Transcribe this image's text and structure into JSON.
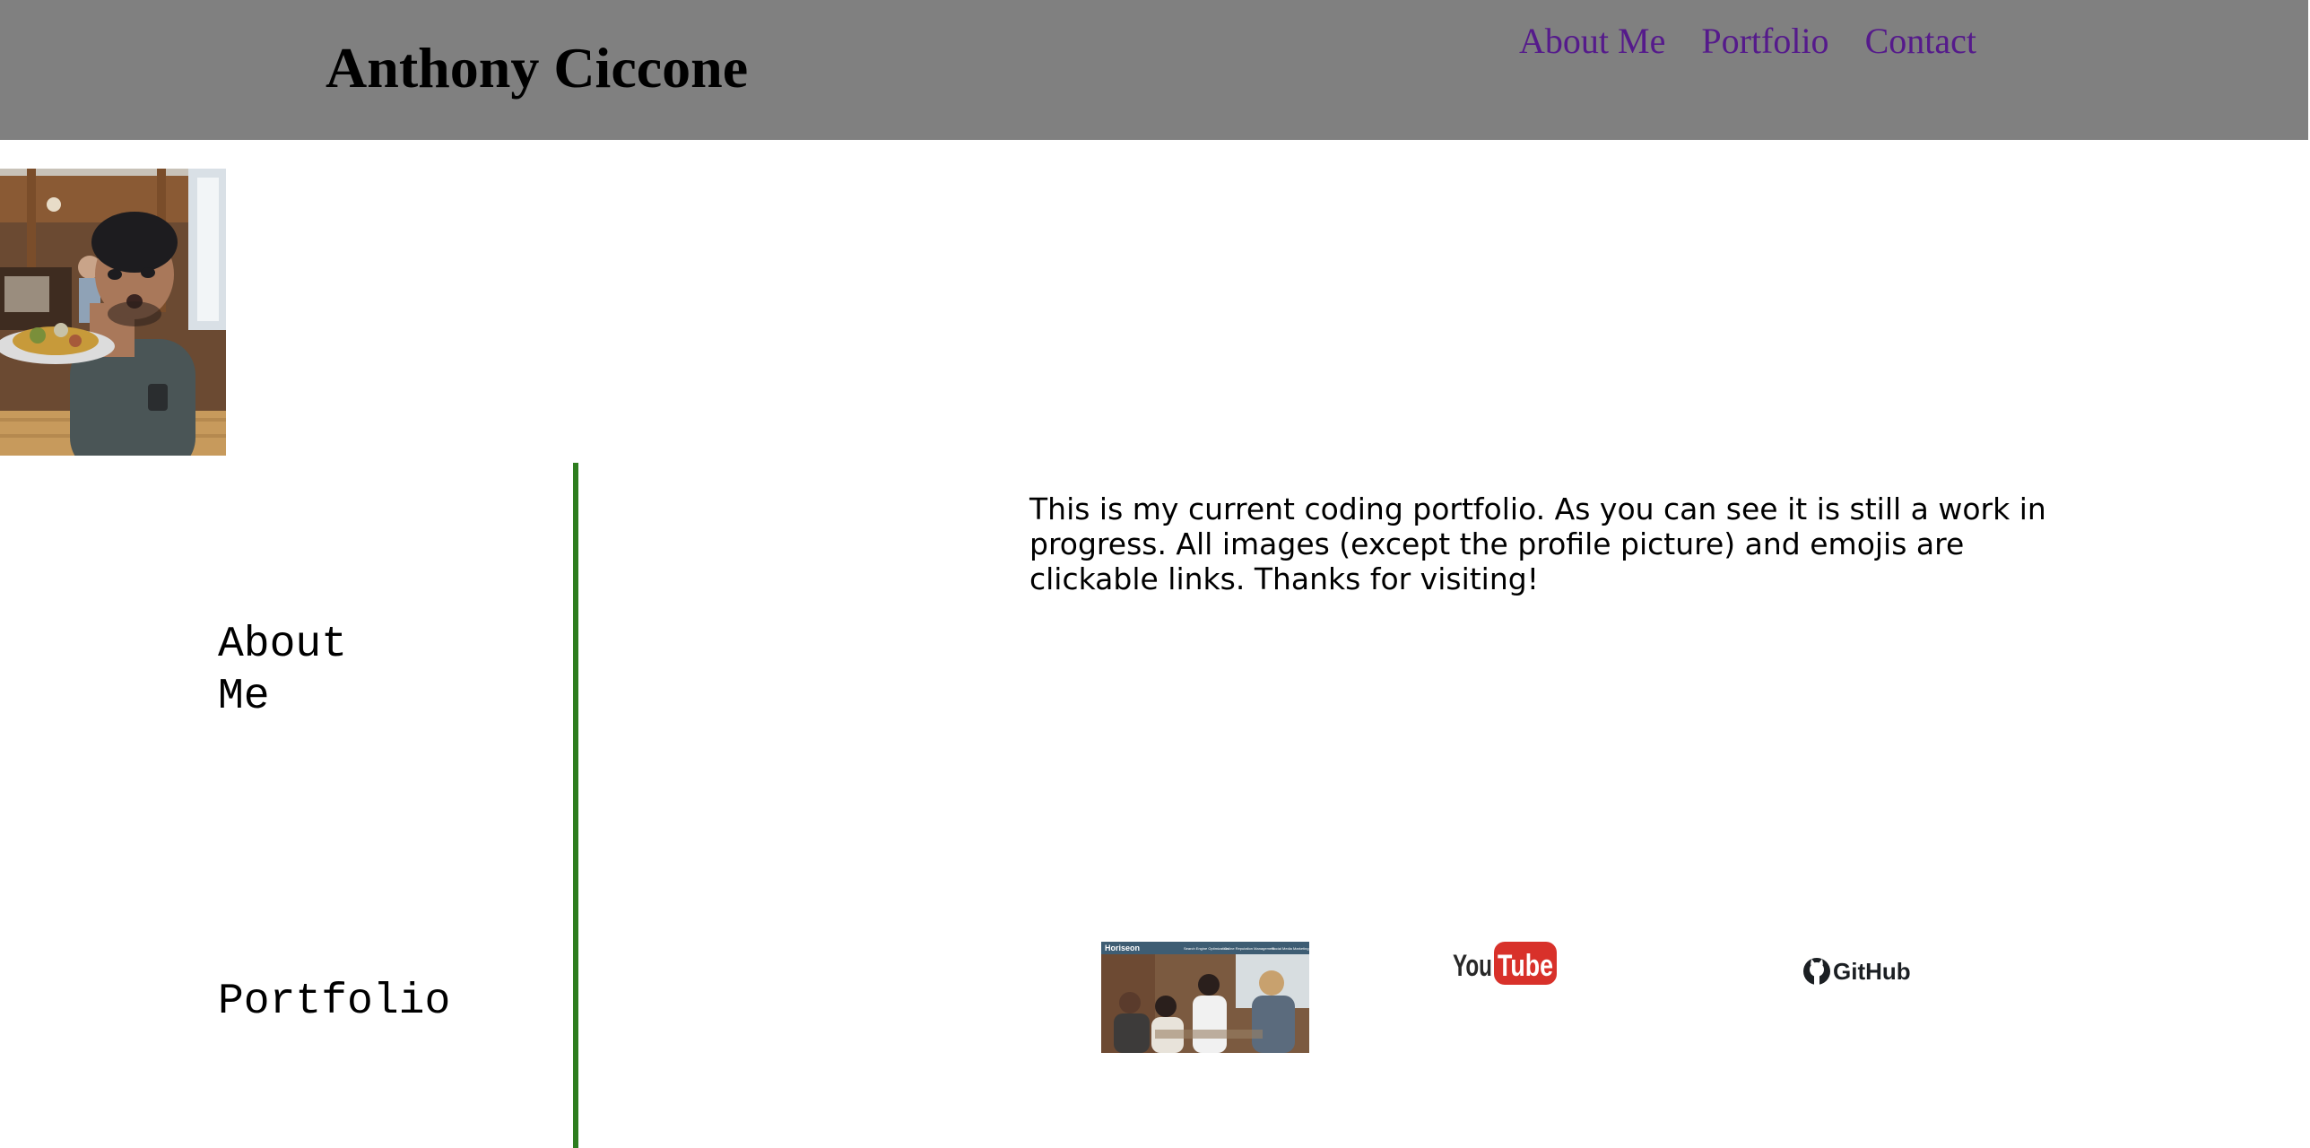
{
  "header": {
    "title": "Anthony Ciccone",
    "nav": [
      "About Me",
      "Portfolio",
      "Contact"
    ]
  },
  "profile": {
    "image_alt": "profile picture"
  },
  "sections": {
    "about_heading": "About Me",
    "portfolio_heading": "Portfolio"
  },
  "intro_text": "This is my current coding portfolio. As you can see it is still a work in progress. All images (except the profile picture) and emojis are clickable links. Thanks for visiting!",
  "links": {
    "horiseon": {
      "logo_text": "Horiseon",
      "nav_items": [
        "Search Engine Optimization",
        "Online Reputation Management",
        "Social Media Marketing"
      ]
    },
    "youtube": {
      "you": "You",
      "tube": "Tube"
    },
    "github": {
      "label": "GitHub"
    }
  },
  "colors": {
    "header_bg": "#808080",
    "nav_link": "#551a8b",
    "divider": "#2e7d1f",
    "youtube_red": "#d8312a"
  }
}
